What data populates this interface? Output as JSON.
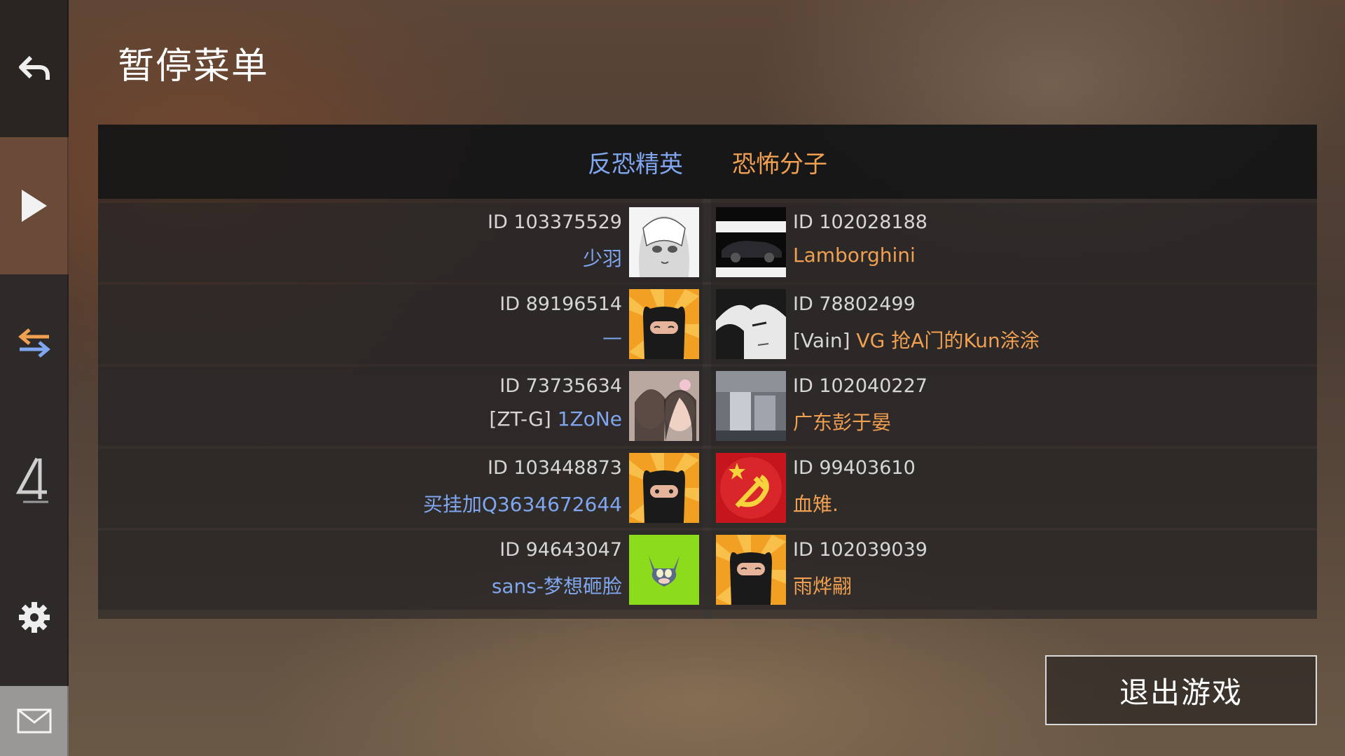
{
  "page": {
    "title": "暂停菜单"
  },
  "sidebar": {
    "back_icon": "back-arrow-icon",
    "play_icon": "play-icon",
    "swap_icon": "swap-team-icon",
    "four_icon": "ranking-4-icon",
    "gear_icon": "gear-icon",
    "mail_icon": "mail-icon"
  },
  "teams": {
    "ct_label": "反恐精英",
    "t_label": "恐怖分子"
  },
  "colors": {
    "ct": "#7fa6ee",
    "t": "#f0a050"
  },
  "players_ct": [
    {
      "id": "ID 103375529",
      "tag": "",
      "name": "少羽",
      "avatar": "anime-girl"
    },
    {
      "id": "ID 89196514",
      "tag": "",
      "name": "—",
      "avatar": "ninja"
    },
    {
      "id": "ID 73735634",
      "tag": "[ZT-G] ",
      "name": "1ZoNe",
      "avatar": "photo-girls"
    },
    {
      "id": "ID 103448873",
      "tag": "",
      "name": "买挂加Q3634672644",
      "avatar": "ninja"
    },
    {
      "id": "ID 94643047",
      "tag": "",
      "name": "sans-梦想砸脸",
      "avatar": "cat"
    }
  ],
  "players_t": [
    {
      "id": "ID 102028188",
      "tag": "",
      "name": "Lamborghini",
      "avatar": "car"
    },
    {
      "id": "ID 78802499",
      "tag": "[Vain] ",
      "name": "VG 抢A门的Kun涂涂",
      "avatar": "anime-boy"
    },
    {
      "id": "ID 102040227",
      "tag": "",
      "name": "广东彭于晏",
      "avatar": "street-photo"
    },
    {
      "id": "ID 99403610",
      "tag": "",
      "name": "血雉.",
      "avatar": "hammer-sickle"
    },
    {
      "id": "ID 102039039",
      "tag": "",
      "name": "雨烨翤",
      "avatar": "ninja"
    }
  ],
  "exit_button": {
    "label": "退出游戏"
  }
}
